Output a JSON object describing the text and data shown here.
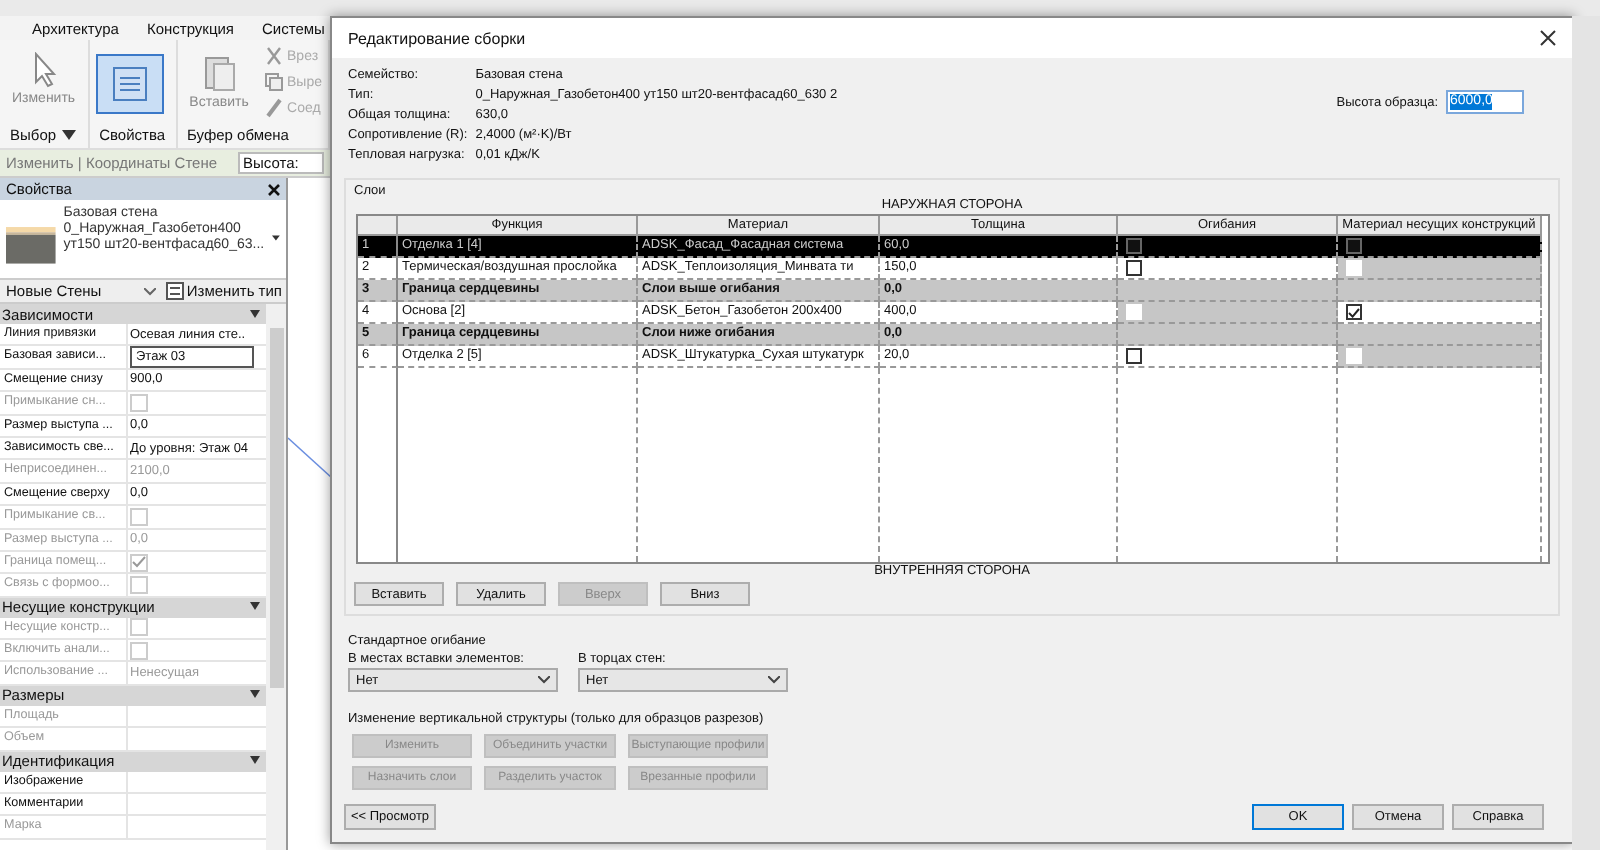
{
  "ribbon": {
    "tabs": [
      {
        "label": "Архитектура",
        "selected": false
      },
      {
        "label": "Конструкция",
        "selected": false
      },
      {
        "label": "Системы",
        "selected": false
      }
    ],
    "panels": [
      {
        "title": "Выбор",
        "dropdown": true,
        "buttons": [
          {
            "kind": "large",
            "label": "Изменить",
            "selected": false
          }
        ]
      },
      {
        "title": "Свойства",
        "dropdown": false,
        "buttons": [
          {
            "kind": "large",
            "selected": true
          }
        ]
      },
      {
        "title": "Буфер обмена",
        "dropdown": false,
        "buttons": [
          {
            "kind": "large",
            "label": "Вставить",
            "selected": false
          },
          {
            "kind": "small",
            "label": "Врез",
            "selected": false
          },
          {
            "kind": "small",
            "label": "Выре",
            "selected": false
          },
          {
            "kind": "small",
            "label": "Соед",
            "selected": false
          }
        ]
      }
    ]
  },
  "options_bar": {
    "context": "Изменить | Координаты Стене",
    "height_label": "Высота:"
  },
  "properties": {
    "title": "Свойства",
    "type_family": "Базовая стена",
    "type_name_lines": [
      "0_Наружная_Газобетон400",
      "ут150 шт20-вентфасад60_63..."
    ],
    "instance_filter": "Новые Стены",
    "edit_type": "Изменить тип",
    "groups": [
      {
        "title": "Зависимости",
        "rows": [
          {
            "label": "Линия привязки",
            "kind": "text",
            "value": "Осевая линия сте..",
            "disabled": false
          },
          {
            "label": "Базовая зависи...",
            "kind": "field",
            "value": "Этаж 03",
            "disabled": false
          },
          {
            "label": "Смещение снизу",
            "kind": "text",
            "value": "900,0",
            "disabled": false
          },
          {
            "label": "Примыкание сн...",
            "kind": "check",
            "checked": false,
            "disabled": true
          },
          {
            "label": "Размер выступа ...",
            "kind": "text",
            "value": "0,0",
            "disabled": false
          },
          {
            "label": "Зависимость све...",
            "kind": "text",
            "value": "До уровня: Этаж 04",
            "disabled": false
          },
          {
            "label": "Неприсоединен...",
            "kind": "text",
            "value": "2100,0",
            "disabled": true
          },
          {
            "label": "Смещение сверху",
            "kind": "text",
            "value": "0,0",
            "disabled": false
          },
          {
            "label": "Примыкание св...",
            "kind": "check",
            "checked": false,
            "disabled": true
          },
          {
            "label": "Размер выступа ...",
            "kind": "text",
            "value": "0,0",
            "disabled": true
          },
          {
            "label": "Граница помещ...",
            "kind": "check",
            "checked": true,
            "disabled": true
          },
          {
            "label": "Связь с формоо...",
            "kind": "check",
            "checked": false,
            "disabled": true
          }
        ]
      },
      {
        "title": "Несущие конструкции",
        "rows": [
          {
            "label": "Несущие констр...",
            "kind": "check",
            "checked": false,
            "disabled": true
          },
          {
            "label": "Включить анали...",
            "kind": "check",
            "checked": false,
            "disabled": true
          },
          {
            "label": "Использование ...",
            "kind": "text",
            "value": "Ненесущая",
            "disabled": true
          }
        ]
      },
      {
        "title": "Размеры",
        "rows": [
          {
            "label": "Площадь",
            "kind": "text",
            "disabled": true
          },
          {
            "label": "Объем",
            "kind": "text",
            "disabled": true
          }
        ]
      },
      {
        "title": "Идентификация",
        "rows": [
          {
            "label": "Изображение",
            "kind": "text",
            "disabled": false
          },
          {
            "label": "Комментарии",
            "kind": "text",
            "disabled": false
          },
          {
            "label": "Марка",
            "kind": "text",
            "disabled": true
          }
        ]
      }
    ]
  },
  "dialog": {
    "title": "Редактирование сборки",
    "info": [
      {
        "label": "Семейство:",
        "value": "Базовая стена"
      },
      {
        "label": "Тип:",
        "value": "0_Наружная_Газобетон400 ут150 шт20-вентфасад60_630 2"
      },
      {
        "label": "Общая толщина:",
        "value": "630,0"
      },
      {
        "label": "Сопротивление (R):",
        "value": "2,4000 (м²·K)/Вт"
      },
      {
        "label": "Тепловая нагрузка:",
        "value": "0,01 кДж/K"
      }
    ],
    "sample_height": {
      "label": "Высота образца:",
      "value": "6000,0"
    },
    "layers": {
      "title": "Слои",
      "exterior_label": "НАРУЖНАЯ СТОРОНА",
      "interior_label": "ВНУТРЕННЯЯ СТОРОНА",
      "columns": [
        "Функция",
        "Материал",
        "Толщина",
        "Огибания",
        "Материал несущих конструкций"
      ],
      "rows": [
        {
          "number": "1",
          "kind": "layer",
          "selected": true,
          "function": "Отделка 1 [4]",
          "material": "ADSK_Фасад_Фасадная система",
          "thickness": "60,0",
          "wraps": {
            "checked": false,
            "disabled": false
          },
          "structural": {
            "checked": false,
            "disabled": false
          }
        },
        {
          "number": "2",
          "kind": "layer",
          "selected": false,
          "function": "Термическая/воздушная прослойка",
          "material": "ADSK_Теплоизоляция_Минвата ти",
          "thickness": "150,0",
          "wraps": {
            "checked": false,
            "disabled": false
          },
          "structural": {
            "checked": false,
            "disabled": true
          }
        },
        {
          "number": "3",
          "kind": "boundary",
          "selected": false,
          "function": "Граница сердцевины",
          "material": "Слои выше огибания",
          "thickness": "0,0"
        },
        {
          "number": "4",
          "kind": "layer",
          "selected": false,
          "function": "Основа [2]",
          "material": "ADSK_Бетон_Газобетон 200х400",
          "thickness": "400,0",
          "wraps": {
            "checked": false,
            "disabled": true
          },
          "structural": {
            "checked": true,
            "disabled": false
          }
        },
        {
          "number": "5",
          "kind": "boundary",
          "selected": false,
          "function": "Граница сердцевины",
          "material": "Слои ниже огибания",
          "thickness": "0,0"
        },
        {
          "number": "6",
          "kind": "layer",
          "selected": false,
          "function": "Отделка 2 [5]",
          "material": "ADSK_Штукатурка_Сухая штукатурк",
          "thickness": "20,0",
          "wraps": {
            "checked": false,
            "disabled": false
          },
          "structural": {
            "checked": false,
            "disabled": true
          }
        }
      ],
      "buttons": [
        {
          "label": "Вставить",
          "disabled": false
        },
        {
          "label": "Удалить",
          "disabled": false
        },
        {
          "label": "Вверх",
          "disabled": true
        },
        {
          "label": "Вниз",
          "disabled": false
        }
      ]
    },
    "default_wrapping": {
      "title": "Стандартное огибание",
      "fields": [
        {
          "label": "В местах вставки элементов:",
          "value": "Нет"
        },
        {
          "label": "В торцах стен:",
          "value": "Нет"
        }
      ]
    },
    "vertical_structure": {
      "title": "Изменение вертикальной структуры (только для образцов разрезов)",
      "buttons": [
        {
          "label": "Изменить",
          "disabled": true
        },
        {
          "label": "Объединить участки",
          "disabled": true
        },
        {
          "label": "Выступающие профили",
          "disabled": true
        },
        {
          "label": "Назначить слои",
          "disabled": true
        },
        {
          "label": "Разделить участок",
          "disabled": true
        },
        {
          "label": "Врезанные профили",
          "disabled": true
        }
      ]
    },
    "preview_button": "<< Просмотр",
    "footer_buttons": [
      {
        "label": "OK",
        "default": true
      },
      {
        "label": "Отмена",
        "default": false
      },
      {
        "label": "Справка",
        "default": false
      }
    ]
  }
}
